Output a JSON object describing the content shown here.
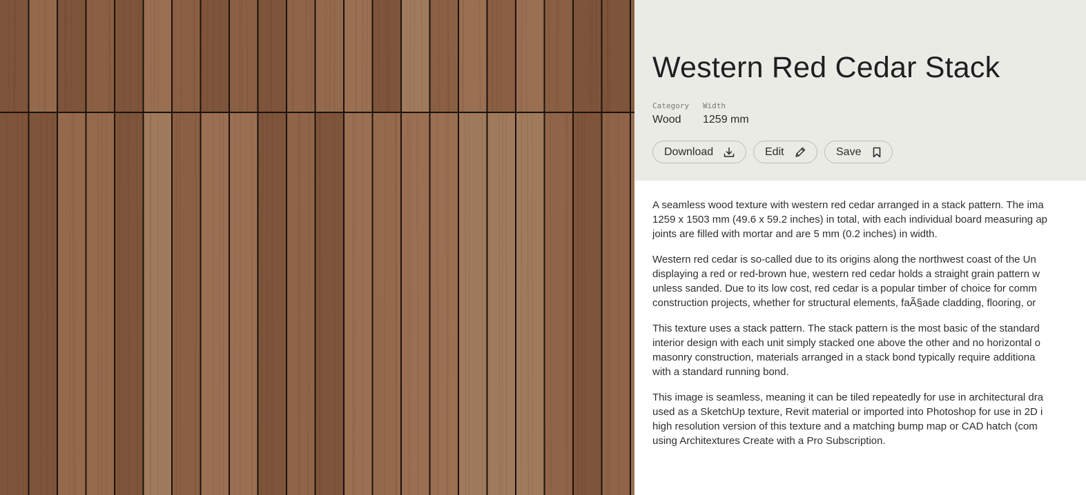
{
  "product": {
    "title": "Western Red Cedar Stack",
    "category_label": "Category",
    "category_value": "Wood",
    "width_label": "Width",
    "width_value": "1259 mm"
  },
  "actions": {
    "download_label": "Download",
    "edit_label": "Edit",
    "save_label": "Save"
  },
  "icons": {
    "download": "download-icon",
    "edit": "pencil-icon",
    "save": "bookmark-icon"
  },
  "description": [
    [
      "A seamless wood texture with western red cedar arranged in a stack pattern. The ima",
      "1259 x 1503 mm (49.6 x 59.2 inches) in total, with each individual board measuring ap",
      "joints are filled with mortar and are 5 mm (0.2 inches) in width."
    ],
    [
      "Western red cedar is so-called due to its origins along the northwest coast of the Un",
      "displaying a red or red-brown hue, western red cedar holds a straight grain pattern w",
      "unless sanded. Due to its low cost, red cedar is a popular timber of choice for comm",
      "construction projects, whether for structural elements, faÃ§ade cladding, flooring, or"
    ],
    [
      "This texture uses a stack pattern. The stack pattern is the most basic of the standard",
      "interior design with each unit simply stacked one above the other and no horizontal o",
      "masonry construction, materials arranged in a stack bond typically require additiona",
      "with a standard running bond."
    ],
    [
      "This image is seamless, meaning it can be tiled repeatedly for use in architectural dra",
      "used as a SketchUp texture, Revit material or imported into Photoshop for use in 2D i",
      "high resolution version of this texture and a matching bump map or CAD hatch (com",
      "using Architextures Create with a Pro Subscription."
    ]
  ],
  "colors": {
    "panel_bg": "#ebebe6",
    "joint": "#1a120c",
    "wood_tones": [
      "#8a5f43",
      "#9a6f52",
      "#7e543a",
      "#a07a5c",
      "#8f6448",
      "#956a4c"
    ]
  }
}
